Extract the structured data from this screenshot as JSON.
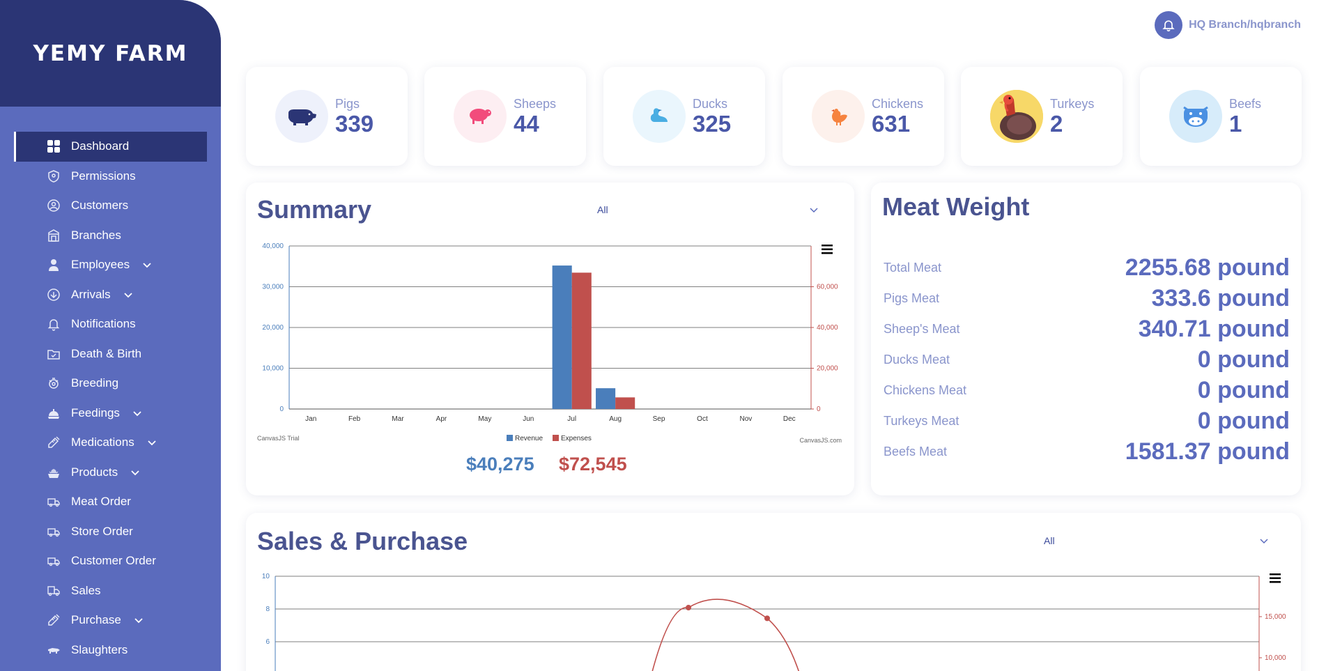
{
  "sidebar": {
    "logo": "YEMY FARM",
    "items": [
      {
        "label": "Dashboard",
        "icon": "dashboard-icon",
        "active": true
      },
      {
        "label": "Permissions",
        "icon": "shield-icon"
      },
      {
        "label": "Customers",
        "icon": "user-circle-icon"
      },
      {
        "label": "Branches",
        "icon": "building-icon"
      },
      {
        "label": "Employees",
        "icon": "person-icon",
        "chevron": true
      },
      {
        "label": "Arrivals",
        "icon": "arrow-circle-icon",
        "chevron": true
      },
      {
        "label": "Notifications",
        "icon": "bell-icon"
      },
      {
        "label": "Death & Birth",
        "icon": "folder-icon"
      },
      {
        "label": "Breeding",
        "icon": "breeding-icon"
      },
      {
        "label": "Feedings",
        "icon": "feeding-icon",
        "chevron": true
      },
      {
        "label": "Medications",
        "icon": "syringe-icon",
        "chevron": true
      },
      {
        "label": "Products",
        "icon": "products-icon",
        "chevron": true
      },
      {
        "label": "Meat Order",
        "icon": "truck-icon"
      },
      {
        "label": "Store Order",
        "icon": "truck-icon"
      },
      {
        "label": "Customer Order",
        "icon": "truck-icon"
      },
      {
        "label": "Sales",
        "icon": "delivery-icon"
      },
      {
        "label": "Purchase",
        "icon": "syringe-icon",
        "chevron": true
      },
      {
        "label": "Slaughters",
        "icon": "slaughter-icon"
      }
    ]
  },
  "header": {
    "user": "HQ Branch/hqbranch"
  },
  "stats": [
    {
      "label": "Pigs",
      "value": "339",
      "icon": "pig-icon",
      "bg": "#eef1fb"
    },
    {
      "label": "Sheeps",
      "value": "44",
      "icon": "sheep-icon",
      "bg": "#fdeef2"
    },
    {
      "label": "Ducks",
      "value": "325",
      "icon": "duck-icon",
      "bg": "#eaf6fd"
    },
    {
      "label": "Chickens",
      "value": "631",
      "icon": "chicken-icon",
      "bg": "#fdf1ec"
    },
    {
      "label": "Turkeys",
      "value": "2",
      "icon": "turkey-icon",
      "bg": "#f7d868"
    },
    {
      "label": "Beefs",
      "value": "1",
      "icon": "cow-icon",
      "bg": "#d7ecfa"
    }
  ],
  "summary": {
    "title": "Summary",
    "filter": "All",
    "watermark_left": "CanvasJS Trial",
    "watermark_right": "CanvasJS.com",
    "total_revenue": "$40,275",
    "total_expenses": "$72,545"
  },
  "chart_data": [
    {
      "type": "bar",
      "categories": [
        "Jan",
        "Feb",
        "Mar",
        "Apr",
        "May",
        "Jun",
        "Jul",
        "Aug",
        "Sep",
        "Oct",
        "Nov",
        "Dec"
      ],
      "series": [
        {
          "name": "Revenue",
          "axis": "left",
          "color": "#4a7ebb",
          "values": [
            0,
            0,
            0,
            0,
            0,
            0,
            35200,
            5100,
            0,
            0,
            0,
            0
          ]
        },
        {
          "name": "Expenses",
          "axis": "right",
          "color": "#c0504d",
          "values": [
            0,
            0,
            0,
            0,
            0,
            0,
            66900,
            5700,
            0,
            0,
            0,
            0
          ]
        }
      ],
      "ylim": [
        0,
        40000
      ],
      "y_ticks": [
        "0",
        "10,000",
        "20,000",
        "30,000",
        "40,000"
      ],
      "y2lim": [
        0,
        80000
      ],
      "y2_ticks": [
        "0",
        "20,000",
        "40,000",
        "60,000"
      ],
      "legend_position": "bottom"
    },
    {
      "type": "line",
      "title": "Sales & Purchase",
      "filter": "All",
      "series": [
        {
          "axis": "right",
          "color": "#c0504d",
          "points": [
            {
              "x": 0.42,
              "y": 16100
            },
            {
              "x": 0.5,
              "y": 14800
            }
          ]
        }
      ],
      "y_ticks": [
        "6",
        "8",
        "10"
      ],
      "ylim": [
        0,
        10
      ],
      "y2_ticks": [
        "10,000",
        "15,000"
      ]
    }
  ],
  "meat": {
    "title": "Meat Weight",
    "rows": [
      {
        "label": "Total Meat",
        "value": "2255.68 pound"
      },
      {
        "label": "Pigs Meat",
        "value": "333.6 pound"
      },
      {
        "label": "Sheep's Meat",
        "value": "340.71 pound"
      },
      {
        "label": "Ducks Meat",
        "value": "0 pound"
      },
      {
        "label": "Chickens Meat",
        "value": "0 pound"
      },
      {
        "label": "Turkeys Meat",
        "value": "0 pound"
      },
      {
        "label": "Beefs Meat",
        "value": "1581.37 pound"
      }
    ]
  },
  "sales": {
    "title": "Sales & Purchase",
    "filter": "All"
  }
}
